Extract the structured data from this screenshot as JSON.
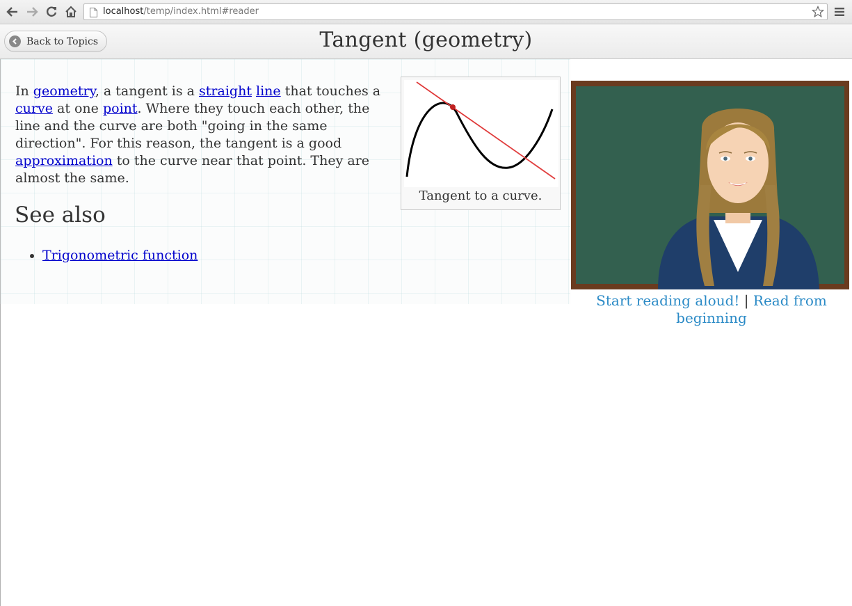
{
  "browser": {
    "url_host": "localhost",
    "url_path": "/temp/index.html#reader"
  },
  "header": {
    "back_label": "Back to Topics",
    "title": "Tangent (geometry)"
  },
  "article": {
    "p1": "In ",
    "link_geometry": "geometry",
    "p2": ", a tangent is a ",
    "link_straight": "straight",
    "p3": " ",
    "link_line": "line",
    "p4": " that touches a ",
    "link_curve": "curve",
    "p5": " at one ",
    "link_point": "point",
    "p6": ". Where they touch each other, the line and the curve are both \"going in the same direction\". For this reason, the tangent is a good ",
    "link_approximation": "approximation",
    "p7": " to the curve near that point. They are almost the same."
  },
  "see_also": {
    "heading": "See also",
    "items": [
      {
        "label": "Trigonometric function"
      }
    ]
  },
  "figure": {
    "caption": "Tangent to a curve."
  },
  "reader": {
    "start_label": "Start reading aloud!",
    "separator": "|",
    "from_beginning_label": "Read from beginning"
  },
  "colors": {
    "link": "#0000cc",
    "reader_link": "#2a8ac6",
    "tangent_line": "#e03c3c",
    "chalkboard": "#2f5b4a"
  }
}
